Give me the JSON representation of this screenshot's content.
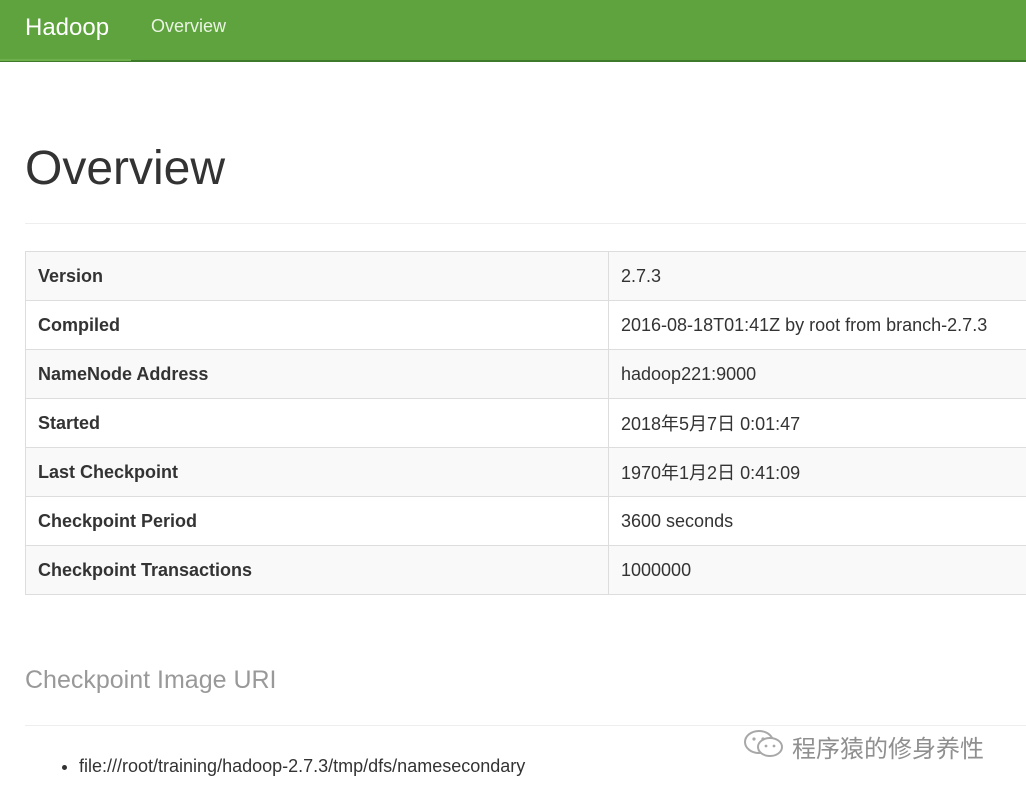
{
  "navbar": {
    "brand": "Hadoop",
    "links": [
      "Overview"
    ]
  },
  "page": {
    "title": "Overview"
  },
  "overview_table": [
    {
      "key": "Version",
      "value": "2.7.3"
    },
    {
      "key": "Compiled",
      "value": "2016-08-18T01:41Z by root from branch-2.7.3"
    },
    {
      "key": "NameNode Address",
      "value": "hadoop221:9000"
    },
    {
      "key": "Started",
      "value": "2018年5月7日 0:01:47"
    },
    {
      "key": "Last Checkpoint",
      "value": "1970年1月2日 0:41:09"
    },
    {
      "key": "Checkpoint Period",
      "value": "3600 seconds"
    },
    {
      "key": "Checkpoint Transactions",
      "value": "1000000"
    }
  ],
  "checkpoint_image": {
    "heading": "Checkpoint Image URI",
    "uris": [
      "file:///root/training/hadoop-2.7.3/tmp/dfs/namesecondary"
    ]
  },
  "watermark": {
    "text": "程序猿的修身养性",
    "icon": "wechat-icon"
  },
  "colors": {
    "navbar_bg": "#5fa33e",
    "navbar_text": "#ffffff",
    "muted_heading": "#999999"
  }
}
